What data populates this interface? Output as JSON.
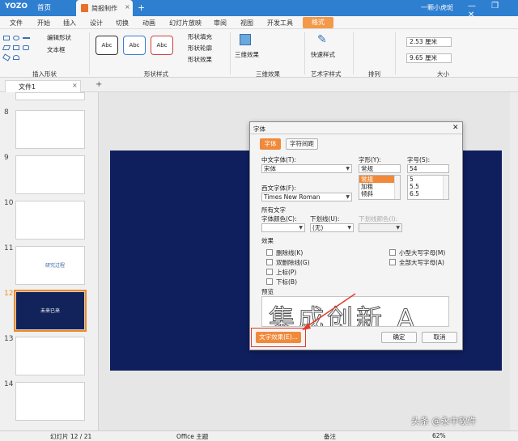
{
  "titlebar": {
    "logo": "YOZO",
    "home_tab": "首页",
    "doc_tab": "简报制作",
    "close": "×",
    "new_tab": "+",
    "user": "一颗小虎斑",
    "window_controls": "—  ❐  ✕"
  },
  "menu": {
    "items": [
      "文件",
      "开始",
      "插入",
      "设计",
      "切换",
      "动画",
      "幻灯片放映",
      "审阅",
      "视图",
      "开发工具"
    ],
    "active": "格式"
  },
  "ribbon": {
    "insert_shape": {
      "edit_shape": "编辑形状",
      "textbox": "文本框",
      "label": "插入形状"
    },
    "shape_style": {
      "abc": [
        "Abc",
        "Abc",
        "Abc"
      ],
      "fill": "形状填充",
      "outline": "形状轮廓",
      "effect": "形状效果",
      "label": "形状样式"
    },
    "three_d": {
      "btn": "三维效果",
      "label": "三维效果"
    },
    "art_text": {
      "btn": "快速样式",
      "label": "艺术字样式"
    },
    "arrange": {
      "label": "排列"
    },
    "size": {
      "height": "2.53 厘米",
      "width": "9.65 厘米",
      "label": "大小"
    }
  },
  "doc_tab": {
    "title": "文件1",
    "close": "×",
    "add": "+"
  },
  "slides": {
    "numbers": [
      "8",
      "9",
      "10",
      "11",
      "12",
      "13",
      "14"
    ],
    "thumb_text_11": "研究过程",
    "thumb_text_12": "未来已来"
  },
  "status": {
    "slide": "幻灯片 12 / 21",
    "theme": "Office 主题",
    "notes": "备注",
    "zoom": "62%",
    "watermark": "头条 @永中软件"
  },
  "dialog": {
    "title": "字体",
    "close": "✕",
    "tabs": [
      "字体",
      "字符间距"
    ],
    "cn_font_label": "中文字体(T):",
    "cn_font_value": "宋体",
    "west_font_label": "西文字体(F):",
    "west_font_value": "Times New Roman",
    "style_label": "字形(Y):",
    "style_value": "常规",
    "style_options": [
      "常规",
      "加粗",
      "倾斜"
    ],
    "size_label": "字号(S):",
    "size_value": "54",
    "size_options": [
      "5",
      "5.5",
      "6.5"
    ],
    "all_text": "所有文字",
    "font_color_label": "字体颜色(C):",
    "underline_label": "下划线(U):",
    "underline_value": "(无)",
    "underline_color_label": "下划线颜色(I):",
    "effects_label": "效果",
    "effects_left": [
      "删除线(K)",
      "双删除线(G)",
      "上标(P)",
      "下标(B)"
    ],
    "effects_right": [
      "小型大写字母(M)",
      "全部大写字母(A)"
    ],
    "preview_label": "预览",
    "preview_text": "集成创新 A",
    "text_effect_btn": "文字效果(E)...",
    "ok": "确定",
    "cancel": "取消"
  },
  "colors": {
    "accent": "#f08a24",
    "titlebar": "#2f7fd1",
    "slide_bg": "#0f1f5e",
    "highlight_box": "#e23b2b"
  }
}
